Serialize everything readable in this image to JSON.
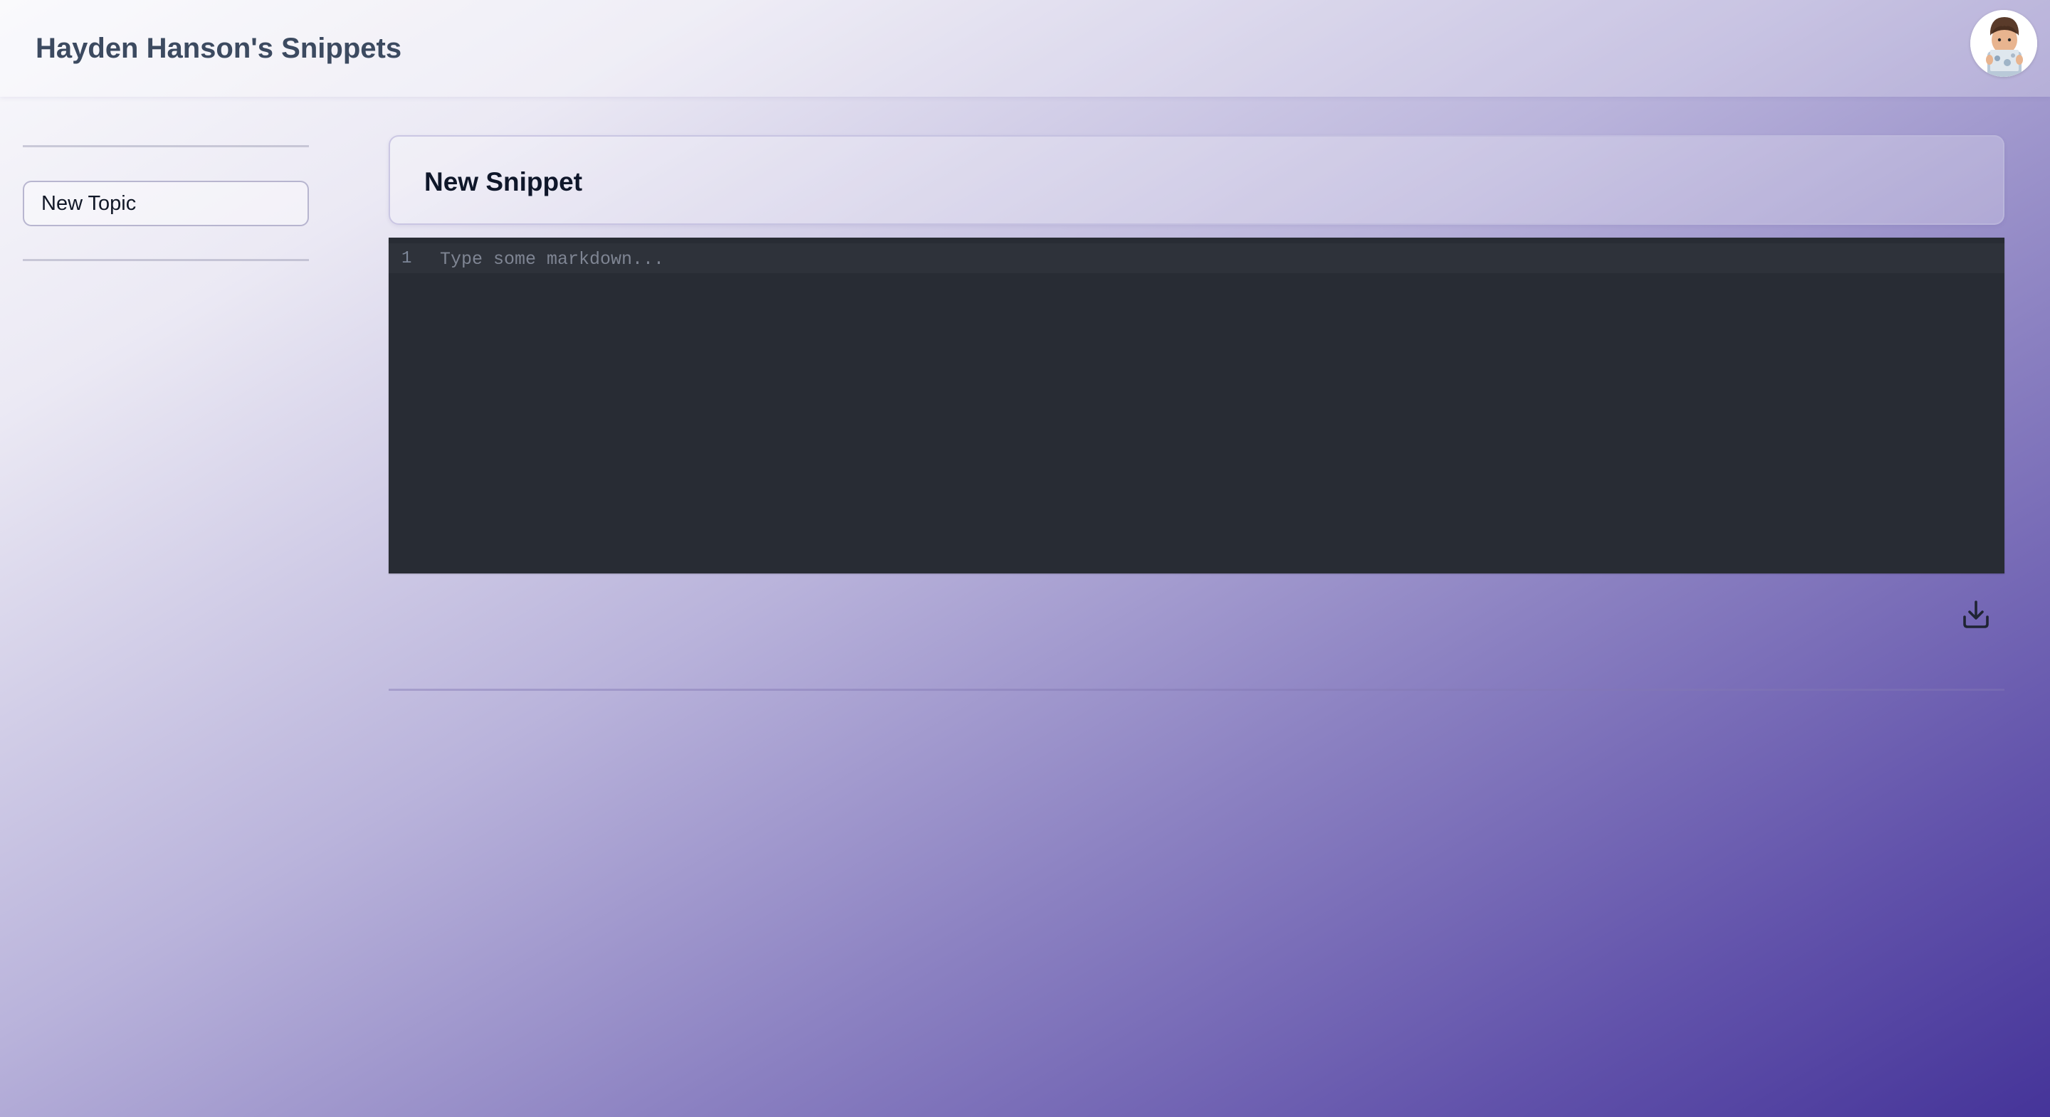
{
  "header": {
    "title": "Hayden Hanson's Snippets",
    "avatar_icon": "memoji-avatar-icon"
  },
  "sidebar": {
    "new_topic_label": "New Topic"
  },
  "snippet": {
    "title": "New Snippet",
    "editor": {
      "line_numbers": [
        "1"
      ],
      "value": "",
      "placeholder": "Type some markdown..."
    },
    "save_icon": "download-tray-icon"
  },
  "colors": {
    "editor_background": "#282c34",
    "title_text": "#3c4a60",
    "gradient_end": "#453499"
  }
}
